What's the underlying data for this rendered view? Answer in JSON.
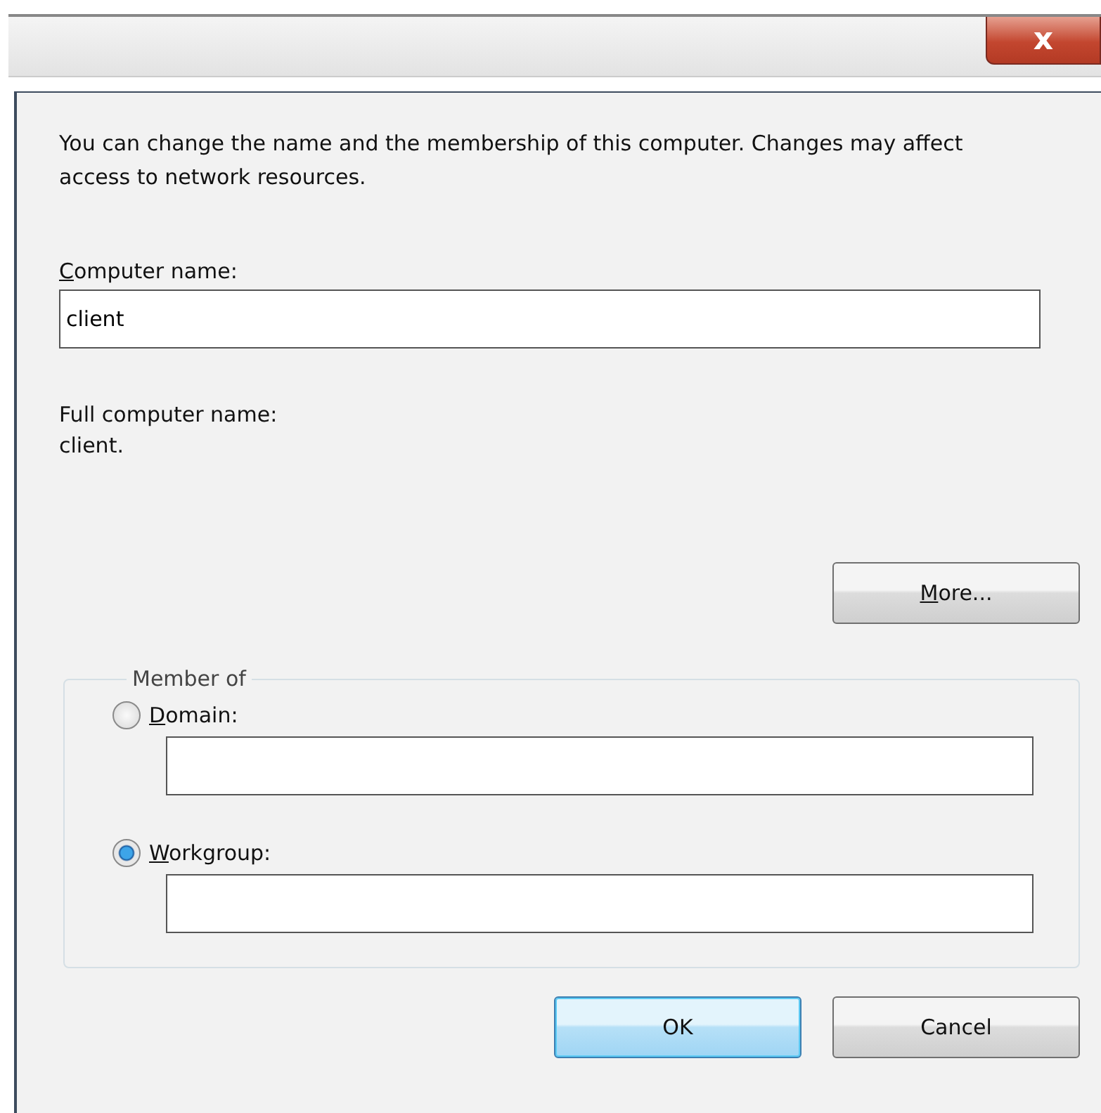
{
  "window": {
    "close_label": "x"
  },
  "description": "You can change the name and the membership of this computer. Changes may affect access to network resources.",
  "computer_name": {
    "label": "Computer name:",
    "mnemonic": true,
    "value": "client"
  },
  "full_name": {
    "label": "Full computer name:",
    "value": "client."
  },
  "more_button": {
    "label": "More...",
    "mnemonic": true
  },
  "member_of": {
    "legend": "Member of",
    "options": [
      {
        "label": "Domain:",
        "mnemonic": true,
        "selected": false
      },
      {
        "label": "Workgroup:",
        "mnemonic": true,
        "selected": true
      }
    ]
  },
  "buttons": [
    {
      "label": "OK",
      "default": true
    },
    {
      "label": "Cancel",
      "default": false
    }
  ]
}
